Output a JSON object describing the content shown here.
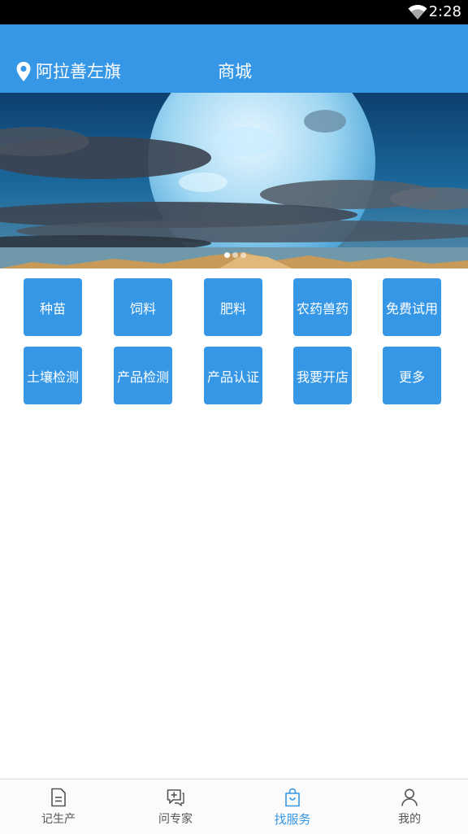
{
  "status_bar": {
    "time": "2:28",
    "wifi_icon": "wifi-icon"
  },
  "header": {
    "location": "阿拉善左旗",
    "location_icon": "location-pin-icon",
    "title": "商城"
  },
  "banner": {
    "slide_count": 3,
    "active_slide": 1
  },
  "services": [
    {
      "label": "种苗"
    },
    {
      "label": "饲料"
    },
    {
      "label": "肥料"
    },
    {
      "label": "农药兽药"
    },
    {
      "label": "免费试用"
    },
    {
      "label": "土壤检测"
    },
    {
      "label": "产品检测"
    },
    {
      "label": "产品认证"
    },
    {
      "label": "我要开店"
    },
    {
      "label": "更多"
    }
  ],
  "tabbar": {
    "accent_color": "#3597e6",
    "items": [
      {
        "label": "记生产",
        "icon": "document-icon",
        "active": false
      },
      {
        "label": "问专家",
        "icon": "chat-plus-icon",
        "active": false
      },
      {
        "label": "找服务",
        "icon": "shopping-bag-icon",
        "active": true
      },
      {
        "label": "我的",
        "icon": "person-icon",
        "active": false
      }
    ]
  },
  "colors": {
    "primary": "#3597e6",
    "status_bar": "#000000",
    "background": "#ffffff"
  }
}
